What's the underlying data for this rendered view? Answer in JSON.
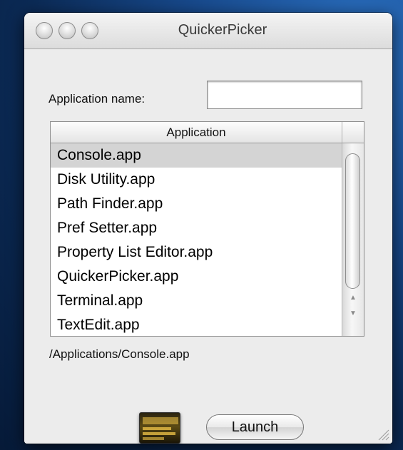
{
  "window": {
    "title": "QuickerPicker",
    "buttons": [
      "close",
      "minimize",
      "zoom"
    ]
  },
  "form": {
    "name_label": "Application name:",
    "name_value": "",
    "name_placeholder": ""
  },
  "table": {
    "column_header": "Application",
    "rows": [
      "Console.app",
      "Disk Utility.app",
      "Path Finder.app",
      "Pref Setter.app",
      "Property List Editor.app",
      "QuickerPicker.app",
      "Terminal.app",
      "TextEdit.app"
    ],
    "selected_index": 0
  },
  "path_label": "/Applications/Console.app",
  "launch_button": "Launch",
  "selected_app_icon": "console-app-icon",
  "colors": {
    "desktop": "#17488a",
    "window": "#ececec",
    "selection": "#d4d4d4"
  }
}
